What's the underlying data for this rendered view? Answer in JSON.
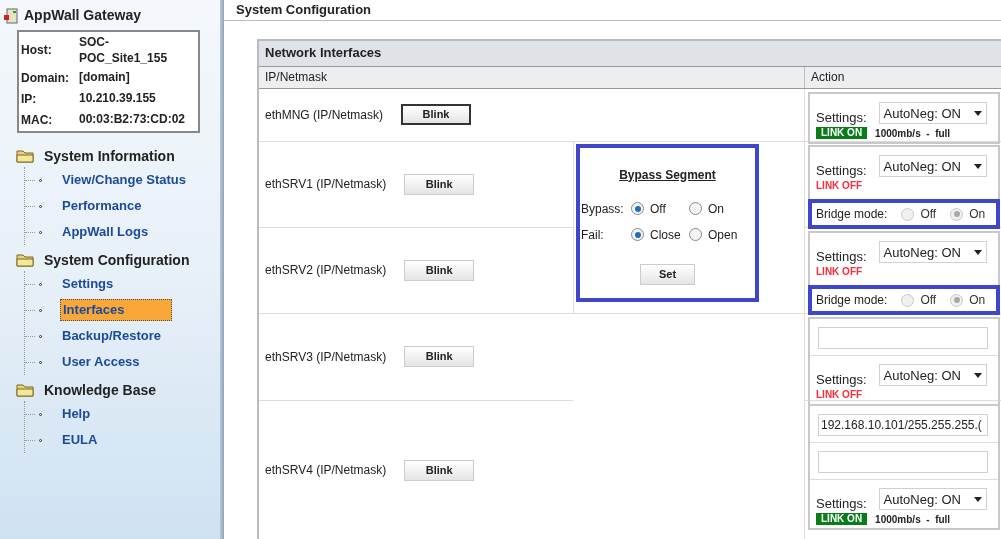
{
  "sidebar": {
    "title": "AppWall Gateway",
    "info": [
      {
        "label": "Host:",
        "value": "SOC-POC_Site1_155"
      },
      {
        "label": "Domain:",
        "value": "[domain]"
      },
      {
        "label": "IP:",
        "value": "10.210.39.155"
      },
      {
        "label": "MAC:",
        "value": "00:03:B2:73:CD:02"
      }
    ],
    "sections": [
      {
        "title": "System Information",
        "items": [
          {
            "label": "View/Change Status",
            "selected": false
          },
          {
            "label": "Performance",
            "selected": false
          },
          {
            "label": "AppWall Logs",
            "selected": false
          }
        ]
      },
      {
        "title": "System Configuration",
        "items": [
          {
            "label": "Settings",
            "selected": false
          },
          {
            "label": "Interfaces",
            "selected": true
          },
          {
            "label": "Backup/Restore",
            "selected": false
          },
          {
            "label": "User Access",
            "selected": false
          }
        ]
      },
      {
        "title": "Knowledge Base",
        "items": [
          {
            "label": "Help",
            "selected": false
          },
          {
            "label": "EULA",
            "selected": false
          }
        ]
      }
    ]
  },
  "page_title": "System Configuration",
  "table": {
    "title": "Network Interfaces",
    "columns": [
      "IP/Netmask",
      "Action"
    ],
    "rows": [
      {
        "name": "ethMNG (IP/Netmask)",
        "button": "Blink",
        "action": {
          "settings_label": "Settings:",
          "select": "AutoNeg: ON",
          "link": {
            "kind": "on",
            "text": "LINK ON"
          },
          "speed": "1000mb/s  -  full"
        }
      },
      {
        "name": "ethSRV1 (IP/Netmask)",
        "button": "Blink",
        "action": {
          "settings_label": "Settings:",
          "select": "AutoNeg: ON",
          "link": {
            "kind": "off",
            "text": "LINK OFF"
          },
          "bridge": {
            "label": "Bridge mode:",
            "options": [
              {
                "label": "Off",
                "selected": false,
                "disabled": true
              },
              {
                "label": "On",
                "selected": true,
                "disabled": true
              }
            ]
          }
        }
      },
      {
        "name": "ethSRV2 (IP/Netmask)",
        "button": "Blink",
        "action": {
          "settings_label": "Settings:",
          "select": "AutoNeg: ON",
          "link": {
            "kind": "off",
            "text": "LINK OFF"
          },
          "bridge": {
            "label": "Bridge mode:",
            "options": [
              {
                "label": "Off",
                "selected": false,
                "disabled": true
              },
              {
                "label": "On",
                "selected": true,
                "disabled": true
              }
            ]
          }
        }
      },
      {
        "name": "ethSRV3 (IP/Netmask)",
        "button": "Blink",
        "action": {
          "fields": [
            {
              "kind": "input"
            }
          ],
          "settings_label": "Settings:",
          "select": "AutoNeg: ON",
          "link": {
            "kind": "off",
            "text": "LINK OFF"
          }
        }
      },
      {
        "name": "ethSRV4 (IP/Netmask)",
        "button": "Blink",
        "action": {
          "fields": [
            {
              "kind": "input",
              "value": "192.168.10.101/255.255.255.("
            },
            {
              "kind": "input"
            }
          ],
          "settings_label": "Settings:",
          "select": "AutoNeg: ON",
          "link": {
            "kind": "on",
            "text": "LINK ON"
          },
          "speed": "1000mb/s  -  full"
        }
      }
    ],
    "bypass": {
      "title": "Bypass Segment",
      "groups": [
        {
          "label": "Bypass:",
          "options": [
            {
              "label": "Off",
              "selected": true
            },
            {
              "label": "On",
              "selected": false
            }
          ]
        },
        {
          "label": "Fail:",
          "options": [
            {
              "label": "Close",
              "selected": true
            },
            {
              "label": "Open",
              "selected": false
            }
          ]
        }
      ],
      "button": "Set"
    }
  }
}
